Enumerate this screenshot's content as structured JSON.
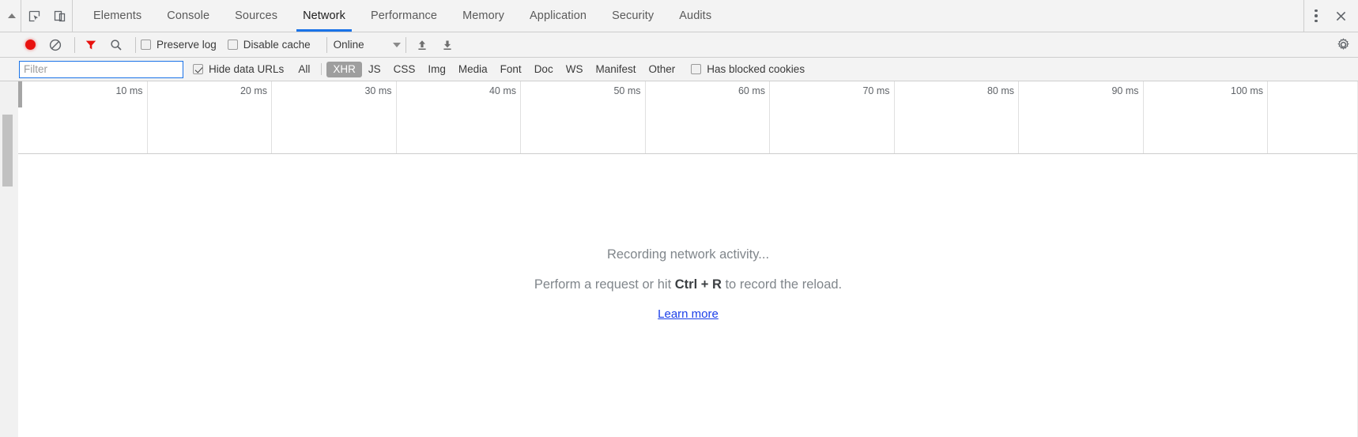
{
  "tabbar": {
    "scroll_up_icon": "triangle-up-icon",
    "inspect_icon": "inspect-element-icon",
    "device_icon": "device-toolbar-icon",
    "tabs": [
      {
        "label": "Elements",
        "active": false
      },
      {
        "label": "Console",
        "active": false
      },
      {
        "label": "Sources",
        "active": false
      },
      {
        "label": "Network",
        "active": true
      },
      {
        "label": "Performance",
        "active": false
      },
      {
        "label": "Memory",
        "active": false
      },
      {
        "label": "Application",
        "active": false
      },
      {
        "label": "Security",
        "active": false
      },
      {
        "label": "Audits",
        "active": false
      }
    ],
    "more_icon": "three-dot-menu-icon",
    "close_icon": "close-icon",
    "accent_color": "#1a73e8"
  },
  "toolbar": {
    "record_icon": "record-button-icon",
    "record_color": "#e8110e",
    "clear_icon": "clear-icon",
    "filter_icon": "filter-funnel-icon",
    "filter_icon_color": "#e8110e",
    "search_icon": "search-icon",
    "preserve_log": {
      "label": "Preserve log",
      "checked": false
    },
    "disable_cache": {
      "label": "Disable cache",
      "checked": false
    },
    "throttling": {
      "value": "Online",
      "caret_icon": "chevron-down-icon"
    },
    "import_icon": "import-har-icon",
    "export_icon": "export-har-icon",
    "settings_icon": "gear-icon"
  },
  "filterbar": {
    "filter_input": {
      "value": "",
      "placeholder": "Filter"
    },
    "hide_data_urls": {
      "label": "Hide data URLs",
      "checked": true
    },
    "chips": [
      {
        "label": "All",
        "active": false
      },
      {
        "label": "XHR",
        "active": true
      },
      {
        "label": "JS",
        "active": false
      },
      {
        "label": "CSS",
        "active": false
      },
      {
        "label": "Img",
        "active": false
      },
      {
        "label": "Media",
        "active": false
      },
      {
        "label": "Font",
        "active": false
      },
      {
        "label": "Doc",
        "active": false
      },
      {
        "label": "WS",
        "active": false
      },
      {
        "label": "Manifest",
        "active": false
      },
      {
        "label": "Other",
        "active": false
      }
    ],
    "has_blocked_cookies": {
      "label": "Has blocked cookies",
      "checked": false
    },
    "active_chip_bg": "#9e9e9e"
  },
  "overview": {
    "ticks": [
      {
        "label": "10 ms"
      },
      {
        "label": "20 ms"
      },
      {
        "label": "30 ms"
      },
      {
        "label": "40 ms"
      },
      {
        "label": "50 ms"
      },
      {
        "label": "60 ms"
      },
      {
        "label": "70 ms"
      },
      {
        "label": "80 ms"
      },
      {
        "label": "90 ms"
      },
      {
        "label": "100 ms"
      }
    ]
  },
  "empty_state": {
    "line1": "Recording network activity...",
    "line2_before": "Perform a request or hit ",
    "line2_key": "Ctrl + R",
    "line2_after": " to record the reload.",
    "learn_more": "Learn more",
    "link_color": "#1a3ee8"
  }
}
